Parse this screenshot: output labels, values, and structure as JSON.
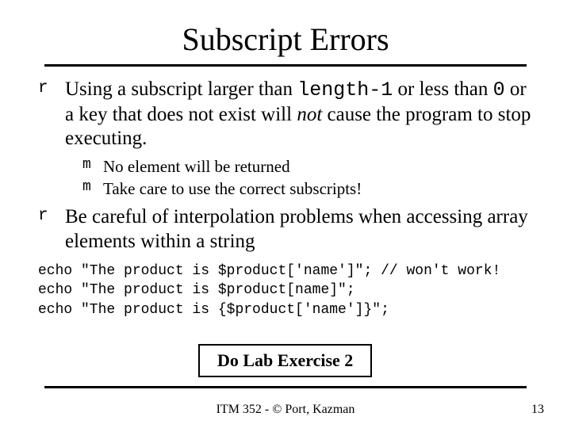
{
  "title": "Subscript Errors",
  "bullets": {
    "b1_pre": "Using a subscript larger than ",
    "b1_code": "length-1",
    "b1_mid": " or less than ",
    "b1_code2": "0",
    "b1_post1": " or a key that does not exist will ",
    "b1_not": "not",
    "b1_post2": " cause the program to stop executing.",
    "sub1": "No element will be returned",
    "sub2": "Take care to use the correct subscripts!",
    "b2": "Be careful of interpolation problems when accessing array elements within a string"
  },
  "markers": {
    "m1a": "r",
    "m1b": "r",
    "m2a": "m",
    "m2b": "m"
  },
  "code": {
    "line1": "echo \"The product is $product['name']\"; // won't work!",
    "line2": "echo \"The product is $product[name]\";",
    "line3": "echo \"The product is {$product['name']}\";"
  },
  "exercise": "Do Lab Exercise 2",
  "footer": "ITM 352 - © Port, Kazman",
  "page": "13"
}
